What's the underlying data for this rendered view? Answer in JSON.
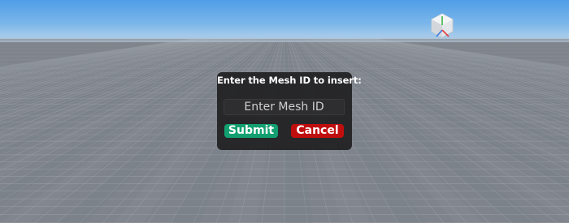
{
  "scene": {
    "sky_color": "#5fa7e8",
    "baseplate_color": "#858a92",
    "gizmo_icon": "view-cube-icon"
  },
  "dialog": {
    "title": "Enter the Mesh ID to insert:",
    "input": {
      "value": "",
      "placeholder": "Enter Mesh ID"
    },
    "submit_label": "Submit",
    "cancel_label": "Cancel",
    "submit_color": "#13a070",
    "cancel_color": "#c00e0e"
  }
}
